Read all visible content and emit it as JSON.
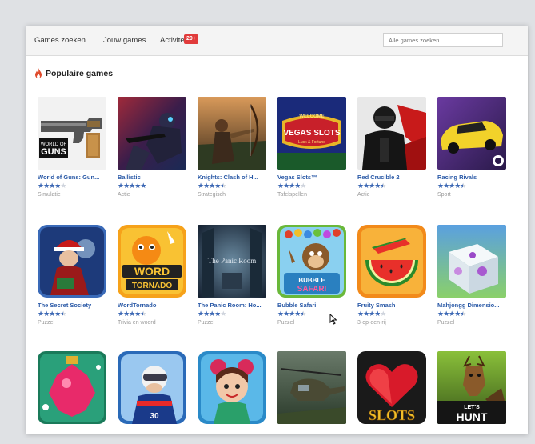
{
  "nav": {
    "search_games": "Games zoeken",
    "your_games": "Jouw games",
    "activity": "Activiteit",
    "activity_badge": "20+",
    "search_placeholder": "Alle games zoeken..."
  },
  "section": {
    "title": "Populaire games"
  },
  "games": [
    {
      "name": "World of Guns: Gun...",
      "rating": 4.0,
      "category": "Simulatie",
      "icon": "gun-icon"
    },
    {
      "name": "Ballistic",
      "rating": 5.0,
      "category": "Actie",
      "icon": "soldier-icon"
    },
    {
      "name": "Knights: Clash of H...",
      "rating": 4.5,
      "category": "Strategisch",
      "icon": "archer-icon"
    },
    {
      "name": "Vegas Slots™",
      "rating": 4.0,
      "category": "Tafelspellen",
      "icon": "vegas-slots-icon"
    },
    {
      "name": "Red Crucible 2",
      "rating": 4.5,
      "category": "Actie",
      "icon": "soldier-mask-icon"
    },
    {
      "name": "Racing Rivals",
      "rating": 4.5,
      "category": "Sport",
      "icon": "race-car-icon"
    },
    {
      "name": "The Secret Society",
      "rating": 4.5,
      "category": "Puzzel",
      "icon": "santa-icon"
    },
    {
      "name": "WordTornado",
      "rating": 4.5,
      "category": "Trivia en woord",
      "icon": "word-tornado-icon"
    },
    {
      "name": "The Panic Room: Ho...",
      "rating": 4.0,
      "category": "Puzzel",
      "icon": "panic-room-icon"
    },
    {
      "name": "Bubble Safari",
      "rating": 4.5,
      "category": "Puzzel",
      "icon": "monkey-icon"
    },
    {
      "name": "Fruity Smash",
      "rating": 4.0,
      "category": "3-op-een-rij",
      "icon": "watermelon-icon"
    },
    {
      "name": "Mahjongg Dimensio...",
      "rating": 4.5,
      "category": "Puzzel",
      "icon": "mahjongg-cube-icon"
    },
    {
      "name": "",
      "rating": 0,
      "category": "",
      "icon": "christmas-ornament-icon"
    },
    {
      "name": "",
      "rating": 0,
      "category": "",
      "icon": "ski-jumper-icon"
    },
    {
      "name": "",
      "rating": 0,
      "category": "",
      "icon": "cartoon-girl-icon"
    },
    {
      "name": "",
      "rating": 0,
      "category": "",
      "icon": "helicopter-icon"
    },
    {
      "name": "",
      "rating": 0,
      "category": "",
      "icon": "heart-slots-icon"
    },
    {
      "name": "",
      "rating": 0,
      "category": "",
      "icon": "deer-hunt-icon"
    }
  ],
  "thumb_text": {
    "guns": [
      "WORLD OF",
      "GUNS"
    ],
    "vegas": [
      "WELCOME",
      "VEGAS SLOTS",
      "Luck & Fortune"
    ],
    "word": [
      "WORD",
      "TORNADO"
    ],
    "panic": "The Panic Room",
    "bubble": [
      "BUBBLE",
      "SAFARI"
    ],
    "slots": "SLOTS",
    "hunt": [
      "LET'S",
      "HUNT"
    ]
  }
}
